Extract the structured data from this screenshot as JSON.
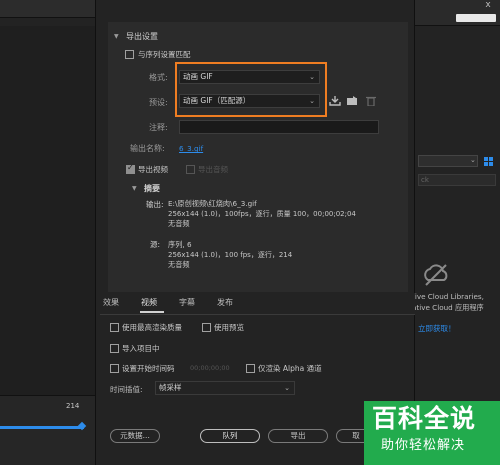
{
  "background_app": {
    "timeline_value": "214",
    "right_search_placeholder": "ck",
    "cc_libraries_line1": "tive Cloud Libraries,",
    "cc_libraries_line2": "ative Cloud 应用程序",
    "cc_link": "立即获取！",
    "close_glyph": "x"
  },
  "export_settings": {
    "section_title": "导出设置",
    "match_sequence_label": "与序列设置匹配",
    "match_sequence_checked": false,
    "format_label": "格式:",
    "format_value": "动画 GIF",
    "preset_label": "预设:",
    "preset_value": "动画 GIF（匹配源）",
    "comment_label": "注释:",
    "comment_value": "",
    "output_name_label": "输出名称:",
    "output_name_value": "6_3.gif",
    "export_video_label": "导出视频",
    "export_video_checked": true,
    "export_audio_label": "导出音频",
    "export_audio_checked": false
  },
  "summary": {
    "title": "摘要",
    "output_label": "输出:",
    "output_line1": "E:\\原创视频\\红烧肉\\6_3.gif",
    "output_line2": "256x144 (1.0)，100fps，逐行，质量 100，00;00;02;04",
    "output_line3": "无音频",
    "source_label": "源:",
    "source_line1": "序列, 6",
    "source_line2": "256x144 (1.0)，100 fps，逐行，214",
    "source_line3": "无音频"
  },
  "tabs": [
    {
      "label": "效果"
    },
    {
      "label": "视频"
    },
    {
      "label": "字幕"
    },
    {
      "label": "发布"
    }
  ],
  "active_tab": "视频",
  "lower": {
    "max_render_quality_label": "使用最高渲染质量",
    "use_previews_label": "使用预览",
    "import_into_project_label": "导入项目中",
    "set_start_timecode_label": "设置开始时间码",
    "start_timecode_value": "00;00;00;00",
    "render_alpha_only_label": "仅渲染 Alpha 通道",
    "time_interpolation_label": "时间插值:",
    "time_interpolation_value": "帧采样"
  },
  "buttons": {
    "metadata": "元数据...",
    "queue": "队列",
    "export": "导出",
    "cancel": "取"
  },
  "watermark": {
    "line1": "百科全说",
    "line2": "助你轻松解决",
    "color": "#22ab4d"
  },
  "colors": {
    "highlight": "#ef7d22",
    "accent_blue": "#2d8ceb"
  }
}
